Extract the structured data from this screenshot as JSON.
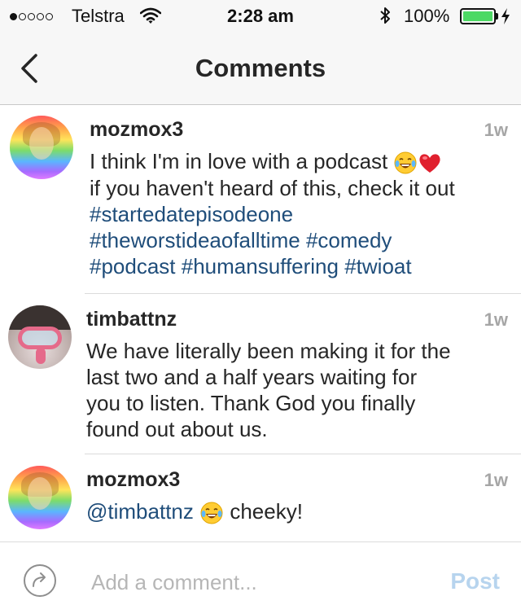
{
  "status_bar": {
    "carrier": "Telstra",
    "time": "2:28 am",
    "battery": "100%",
    "signal_bars_filled": 1,
    "signal_bars_total": 5
  },
  "header": {
    "title": "Comments",
    "back_icon": "chevron-left-icon"
  },
  "comments": [
    {
      "username": "mozmox3",
      "time": "1w",
      "lines": [
        [
          {
            "t": "text",
            "v": "I think I'm in love with a podcast "
          },
          {
            "t": "emoji",
            "v": "laughing-tears-emoji"
          },
          {
            "t": "emoji",
            "v": "red-heart-emoji"
          }
        ],
        [
          {
            "t": "text",
            "v": "if you haven't heard of this, check it out"
          }
        ],
        [
          {
            "t": "tag",
            "v": "#startedatepisodeone"
          }
        ],
        [
          {
            "t": "tag",
            "v": "#theworstideaofalltime"
          },
          {
            "t": "text",
            "v": " "
          },
          {
            "t": "tag",
            "v": "#comedy"
          }
        ],
        [
          {
            "t": "tag",
            "v": "#podcast"
          },
          {
            "t": "text",
            "v": " "
          },
          {
            "t": "tag",
            "v": "#humansuffering"
          },
          {
            "t": "text",
            "v": " "
          },
          {
            "t": "tag",
            "v": "#twioat"
          }
        ]
      ]
    },
    {
      "username": "timbattnz",
      "time": "1w",
      "lines": [
        [
          {
            "t": "text",
            "v": "We have literally been making it for the"
          }
        ],
        [
          {
            "t": "text",
            "v": "last two and a half years waiting for"
          }
        ],
        [
          {
            "t": "text",
            "v": "you to listen. Thank God you finally"
          }
        ],
        [
          {
            "t": "text",
            "v": "found out about us."
          }
        ]
      ]
    },
    {
      "username": "mozmox3",
      "time": "1w",
      "lines": [
        [
          {
            "t": "mention",
            "v": "@timbattnz"
          },
          {
            "t": "text",
            "v": " "
          },
          {
            "t": "emoji",
            "v": "laughing-tears-emoji"
          },
          {
            "t": "text",
            "v": " cheeky!"
          }
        ]
      ]
    }
  ],
  "composer": {
    "placeholder": "Add a comment...",
    "value": "",
    "post_label": "Post"
  },
  "colors": {
    "hashtag": "#1f4d7a",
    "post_disabled": "#b7d4ee",
    "battery_fill": "#4cd964"
  }
}
